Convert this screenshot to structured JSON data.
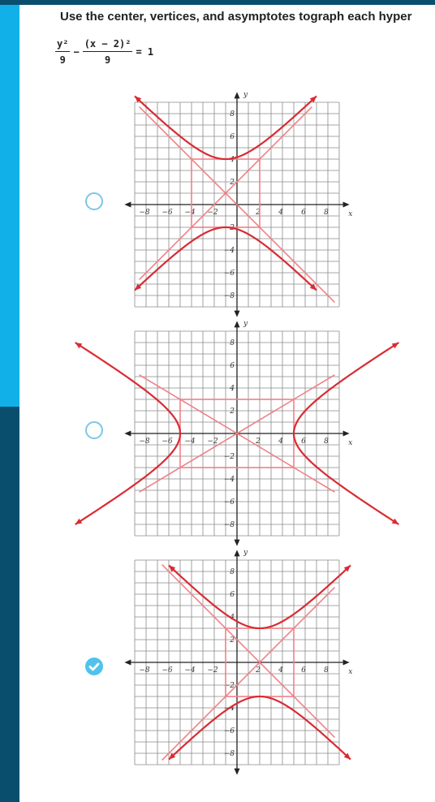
{
  "question": {
    "text": "Use the center, vertices, and asymptotes tograph each hyper",
    "equation": {
      "term1_numerator": "y²",
      "term1_denominator": "9",
      "operator": "−",
      "term2_numerator": "(x − 2)²",
      "term2_denominator": "9",
      "equals": "= 1"
    }
  },
  "options": [
    {
      "selected": false,
      "graph": {
        "x_ticks": [
          "−8",
          "−6",
          "−4",
          "−2",
          "2",
          "4",
          "6",
          "8"
        ],
        "y_ticks": [
          "8",
          "6",
          "4",
          "2",
          "−2",
          "−4",
          "−6",
          "−8"
        ],
        "x_label": "x",
        "y_label": "y",
        "center": [
          -1,
          1
        ],
        "a": 3,
        "b": 3,
        "opens": "vertical"
      }
    },
    {
      "selected": false,
      "graph": {
        "x_ticks": [
          "−8",
          "−6",
          "−4",
          "−2",
          "2",
          "4",
          "6",
          "8"
        ],
        "y_ticks": [
          "8",
          "6",
          "4",
          "2",
          "−2",
          "−4",
          "−6",
          "−8"
        ],
        "x_label": "x",
        "y_label": "y",
        "center": [
          0,
          0
        ],
        "a": 5,
        "b": 3,
        "opens": "horizontal"
      }
    },
    {
      "selected": true,
      "graph": {
        "x_ticks": [
          "−8",
          "−6",
          "−4",
          "−2",
          "2",
          "4",
          "6",
          "8"
        ],
        "y_ticks": [
          "8",
          "6",
          "4",
          "2",
          "−2",
          "−4",
          "−6",
          "−8"
        ],
        "x_label": "x",
        "y_label": "y",
        "center": [
          2,
          0
        ],
        "a": 3,
        "b": 3,
        "opens": "vertical"
      }
    }
  ],
  "colors": {
    "curve": "#d92b33",
    "asymptote": "#f08088",
    "grid": "#8a8a8a",
    "radio_border": "#7cc7e8",
    "radio_checked": "#4fc3ec",
    "rail_dark": "#0a4e6e",
    "rail_light": "#11b0e8"
  }
}
